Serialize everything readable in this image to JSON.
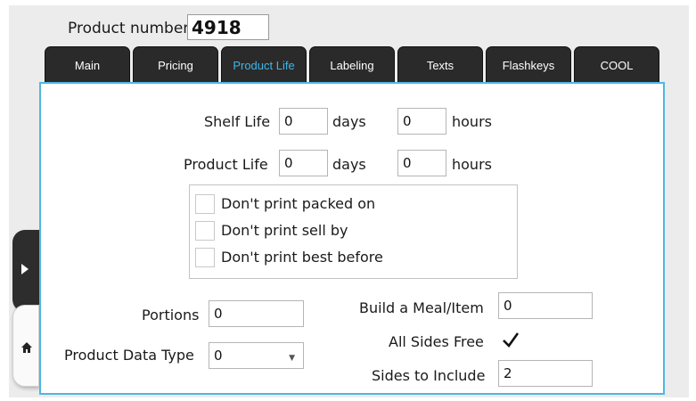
{
  "header": {
    "product_number_label": "Product number",
    "product_number_value": "4918"
  },
  "tabs": [
    {
      "label": "Main",
      "active": false
    },
    {
      "label": "Pricing",
      "active": false
    },
    {
      "label": "Product Life",
      "active": true
    },
    {
      "label": "Labeling",
      "active": false
    },
    {
      "label": "Texts",
      "active": false
    },
    {
      "label": "Flashkeys",
      "active": false
    },
    {
      "label": "COOL",
      "active": false
    }
  ],
  "shelf_life": {
    "label": "Shelf Life",
    "days_value": "0",
    "days_unit": "days",
    "hours_value": "0",
    "hours_unit": "hours"
  },
  "product_life": {
    "label": "Product Life",
    "days_value": "0",
    "days_unit": "days",
    "hours_value": "0",
    "hours_unit": "hours"
  },
  "print_options": [
    {
      "label": "Don't print packed on",
      "checked": false
    },
    {
      "label": "Don't print sell by",
      "checked": false
    },
    {
      "label": "Don't print best before",
      "checked": false
    }
  ],
  "portions": {
    "label": "Portions",
    "value": "0"
  },
  "product_data_type": {
    "label": "Product Data Type",
    "value": "0"
  },
  "build_a_meal": {
    "label": "Build a Meal/Item",
    "value": "0"
  },
  "all_sides_free": {
    "label": "All Sides Free",
    "checked": true
  },
  "sides_to_include": {
    "label": "Sides to Include",
    "value": "2"
  },
  "side_nav": {
    "next_icon": "play-arrow-icon",
    "home_icon": "home-icon"
  },
  "colors": {
    "accent": "#4fb6e1",
    "active_tab_text": "#3fb6e8",
    "tab_background": "#2a2a2a",
    "screen_background": "#ececec"
  }
}
